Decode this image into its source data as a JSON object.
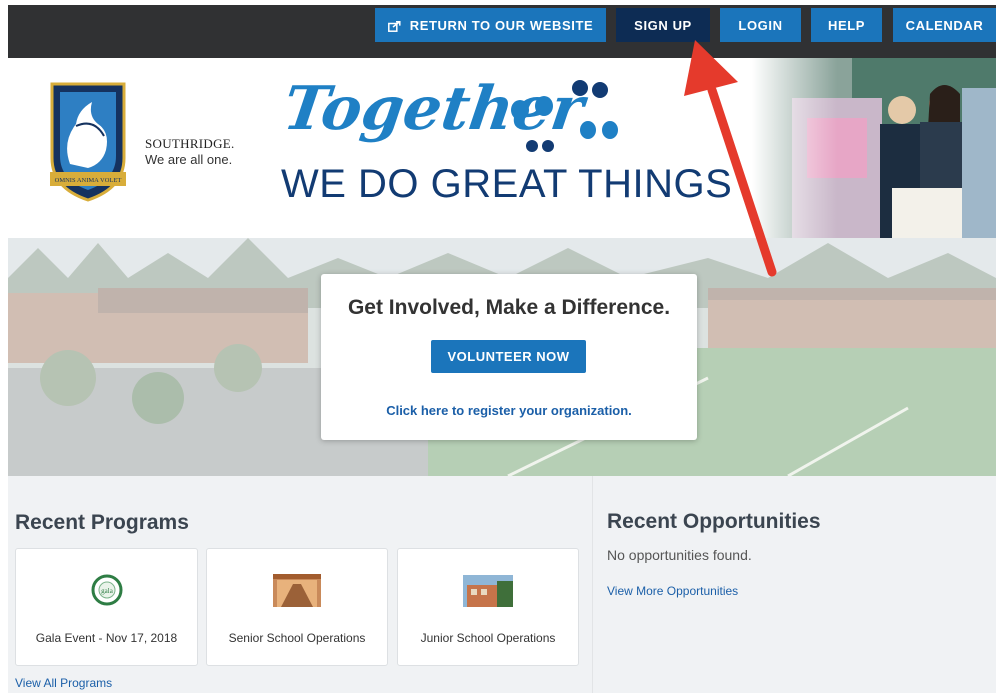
{
  "nav": {
    "return_label": "RETURN TO OUR WEBSITE",
    "signup_label": "SIGN UP",
    "login_label": "LOGIN",
    "help_label": "HELP",
    "calendar_label": "CALENDAR",
    "return_icon": "external-link-icon"
  },
  "header": {
    "school_name": "SOUTHRIDGE.",
    "school_tagline": "We are all one.",
    "crest_motto": "OMNIS ANIMA VOLET",
    "banner_script": "Together",
    "banner_line": "WE DO GREAT THINGS"
  },
  "hero": {
    "heading": "Get Involved, Make a Difference.",
    "volunteer_label": "VOLUNTEER NOW",
    "register_link": "Click here to register your organization."
  },
  "programs": {
    "title": "Recent Programs",
    "items": [
      {
        "label": "Gala Event - Nov 17, 2018"
      },
      {
        "label": "Senior School Operations"
      },
      {
        "label": "Junior School Operations"
      }
    ],
    "view_all": "View All Programs"
  },
  "opportunities": {
    "title": "Recent Opportunities",
    "empty_text": "No opportunities found.",
    "view_more": "View More Opportunities"
  },
  "colors": {
    "primary_blue": "#1b75bb",
    "navy": "#0d2c54",
    "topbar": "#303133",
    "annotation_arrow": "#e53a2c"
  }
}
